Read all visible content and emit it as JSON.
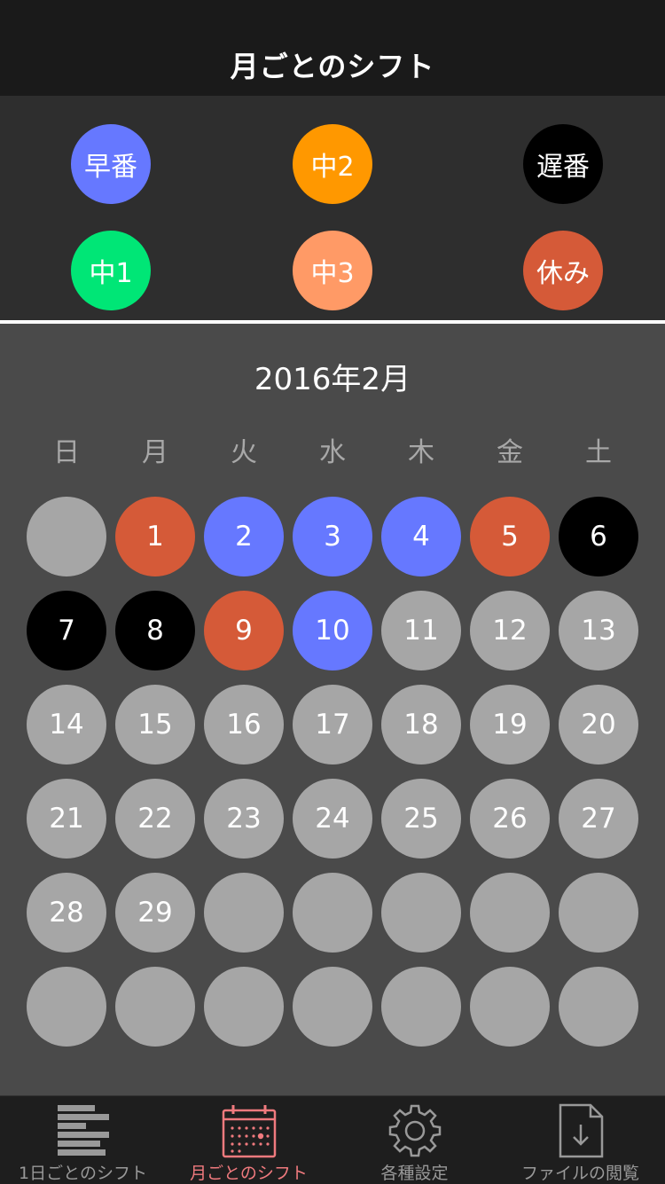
{
  "header": {
    "title": "月ごとのシフト"
  },
  "legend": [
    {
      "label": "早番",
      "color": "#6678ff"
    },
    {
      "label": "中2",
      "color": "#ff9800"
    },
    {
      "label": "遅番",
      "color": "#000000"
    },
    {
      "label": "中1",
      "color": "#00e676"
    },
    {
      "label": "中3",
      "color": "#ff9a66"
    },
    {
      "label": "休み",
      "color": "#d55a38"
    }
  ],
  "calendar": {
    "month_title": "2016年2月",
    "weekdays": [
      "日",
      "月",
      "火",
      "水",
      "木",
      "金",
      "土"
    ],
    "empty_color": "#a6a6a6",
    "days": [
      {
        "label": "",
        "color": "#a6a6a6"
      },
      {
        "label": "1",
        "color": "#d55a38"
      },
      {
        "label": "2",
        "color": "#6678ff"
      },
      {
        "label": "3",
        "color": "#6678ff"
      },
      {
        "label": "4",
        "color": "#6678ff"
      },
      {
        "label": "5",
        "color": "#d55a38"
      },
      {
        "label": "6",
        "color": "#000000"
      },
      {
        "label": "7",
        "color": "#000000"
      },
      {
        "label": "8",
        "color": "#000000"
      },
      {
        "label": "9",
        "color": "#d55a38"
      },
      {
        "label": "10",
        "color": "#6678ff"
      },
      {
        "label": "11",
        "color": "#a6a6a6"
      },
      {
        "label": "12",
        "color": "#a6a6a6"
      },
      {
        "label": "13",
        "color": "#a6a6a6"
      },
      {
        "label": "14",
        "color": "#a6a6a6"
      },
      {
        "label": "15",
        "color": "#a6a6a6"
      },
      {
        "label": "16",
        "color": "#a6a6a6"
      },
      {
        "label": "17",
        "color": "#a6a6a6"
      },
      {
        "label": "18",
        "color": "#a6a6a6"
      },
      {
        "label": "19",
        "color": "#a6a6a6"
      },
      {
        "label": "20",
        "color": "#a6a6a6"
      },
      {
        "label": "21",
        "color": "#a6a6a6"
      },
      {
        "label": "22",
        "color": "#a6a6a6"
      },
      {
        "label": "23",
        "color": "#a6a6a6"
      },
      {
        "label": "24",
        "color": "#a6a6a6"
      },
      {
        "label": "25",
        "color": "#a6a6a6"
      },
      {
        "label": "26",
        "color": "#a6a6a6"
      },
      {
        "label": "27",
        "color": "#a6a6a6"
      },
      {
        "label": "28",
        "color": "#a6a6a6"
      },
      {
        "label": "29",
        "color": "#a6a6a6"
      },
      {
        "label": "",
        "color": "#a6a6a6"
      },
      {
        "label": "",
        "color": "#a6a6a6"
      },
      {
        "label": "",
        "color": "#a6a6a6"
      },
      {
        "label": "",
        "color": "#a6a6a6"
      },
      {
        "label": "",
        "color": "#a6a6a6"
      },
      {
        "label": "",
        "color": "#a6a6a6"
      },
      {
        "label": "",
        "color": "#a6a6a6"
      },
      {
        "label": "",
        "color": "#a6a6a6"
      },
      {
        "label": "",
        "color": "#a6a6a6"
      },
      {
        "label": "",
        "color": "#a6a6a6"
      },
      {
        "label": "",
        "color": "#a6a6a6"
      },
      {
        "label": "",
        "color": "#a6a6a6"
      }
    ]
  },
  "tabbar": {
    "tabs": [
      {
        "label": "1日ごとのシフト",
        "icon": "daily-list-icon"
      },
      {
        "label": "月ごとのシフト",
        "icon": "calendar-icon",
        "active": true
      },
      {
        "label": "各種設定",
        "icon": "gear-icon"
      },
      {
        "label": "ファイルの閲覧",
        "icon": "file-download-icon"
      }
    ],
    "active_color": "#f07a7e",
    "inactive_color": "#999999"
  }
}
